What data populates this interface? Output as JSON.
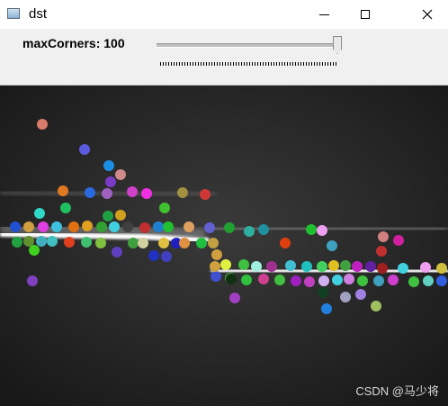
{
  "window": {
    "title": "dst"
  },
  "toolbar": {
    "label": "maxCorners: 100",
    "slider_value": 100,
    "slider_max": 100
  },
  "watermark": "CSDN @马少将",
  "corners": [
    [
      "#d97b6a",
      47,
      138
    ],
    [
      "#5b5be0",
      94,
      166
    ],
    [
      "#1b8fe6",
      121,
      184
    ],
    [
      "#d08a8a",
      134,
      194
    ],
    [
      "#7a3ac8",
      123,
      202
    ],
    [
      "#e07820",
      70,
      212
    ],
    [
      "#2a6ae0",
      100,
      214
    ],
    [
      "#a060c0",
      119,
      215
    ],
    [
      "#d040c8",
      147,
      213
    ],
    [
      "#f030e0",
      163,
      215
    ],
    [
      "#a09040",
      203,
      214
    ],
    [
      "#d03838",
      228,
      216
    ],
    [
      "#20c060",
      73,
      231
    ],
    [
      "#40c030",
      183,
      231
    ],
    [
      "#30d8c8",
      44,
      237
    ],
    [
      "#20a040",
      120,
      240
    ],
    [
      "#d0a020",
      134,
      239
    ],
    [
      "#2050d0",
      17,
      252
    ],
    [
      "#d0a040",
      32,
      252
    ],
    [
      "#e040e0",
      48,
      252
    ],
    [
      "#40c0e0",
      63,
      252
    ],
    [
      "#e07010",
      82,
      252
    ],
    [
      "#e0a020",
      97,
      251
    ],
    [
      "#30a030",
      113,
      252
    ],
    [
      "#40d0e0",
      127,
      252
    ],
    [
      "#404040",
      142,
      252
    ],
    [
      "#c03030",
      161,
      253
    ],
    [
      "#2080d0",
      176,
      252
    ],
    [
      "#20c030",
      187,
      252
    ],
    [
      "#e0a060",
      210,
      252
    ],
    [
      "#6060d0",
      233,
      253
    ],
    [
      "#20a030",
      255,
      253
    ],
    [
      "#30b0a0",
      277,
      257
    ],
    [
      "#2090a0",
      293,
      255
    ],
    [
      "#20c030",
      346,
      255
    ],
    [
      "#f0a0f0",
      358,
      256
    ],
    [
      "#20a040",
      19,
      269
    ],
    [
      "#609030",
      32,
      268
    ],
    [
      "#40b0c0",
      46,
      268
    ],
    [
      "#40c0c0",
      58,
      268
    ],
    [
      "#e04020",
      77,
      269
    ],
    [
      "#40c070",
      96,
      269
    ],
    [
      "#80c040",
      112,
      270
    ],
    [
      "#40a040",
      148,
      270
    ],
    [
      "#d0d0a0",
      159,
      270
    ],
    [
      "#e0c040",
      182,
      270
    ],
    [
      "#2020c0",
      196,
      270
    ],
    [
      "#e09040",
      205,
      270
    ],
    [
      "#20c040",
      224,
      270
    ],
    [
      "#c0a040",
      237,
      270
    ],
    [
      "#e04010",
      317,
      270
    ],
    [
      "#40a0c0",
      369,
      273
    ],
    [
      "#d020a0",
      443,
      267
    ],
    [
      "#d0a040",
      241,
      283
    ],
    [
      "#40d020",
      38,
      278
    ],
    [
      "#6040c0",
      130,
      280
    ],
    [
      "#2030c0",
      171,
      284
    ],
    [
      "#4040c0",
      185,
      285
    ],
    [
      "#c03030",
      424,
      279
    ],
    [
      "#e0f040",
      251,
      294
    ],
    [
      "#40c040",
      271,
      294
    ],
    [
      "#a0f0e0",
      285,
      296
    ],
    [
      "#a03090",
      302,
      296
    ],
    [
      "#40c0d0",
      323,
      295
    ],
    [
      "#20c0c0",
      341,
      296
    ],
    [
      "#40d060",
      358,
      296
    ],
    [
      "#e0c020",
      371,
      295
    ],
    [
      "#40a040",
      384,
      295
    ],
    [
      "#c020c0",
      397,
      296
    ],
    [
      "#6020a0",
      412,
      296
    ],
    [
      "#a02020",
      425,
      298
    ],
    [
      "#40d0e0",
      448,
      298
    ],
    [
      "#f0a0f0",
      473,
      297
    ],
    [
      "#d0c040",
      491,
      298
    ],
    [
      "#4050d0",
      240,
      307
    ],
    [
      "#40a040",
      256,
      309
    ],
    [
      "#30c040",
      274,
      311
    ],
    [
      "#d04090",
      293,
      310
    ],
    [
      "#40c040",
      311,
      311
    ],
    [
      "#a020c0",
      329,
      312
    ],
    [
      "#c040c0",
      344,
      313
    ],
    [
      "#d0b0f0",
      360,
      312
    ],
    [
      "#40d0e0",
      375,
      311
    ],
    [
      "#d080e0",
      388,
      310
    ],
    [
      "#40c040",
      403,
      312
    ],
    [
      "#40a0c0",
      421,
      312
    ],
    [
      "#d040d0",
      437,
      311
    ],
    [
      "#40c040",
      460,
      313
    ],
    [
      "#60d0c0",
      476,
      312
    ],
    [
      "#3060e0",
      491,
      312
    ],
    [
      "#8040c0",
      36,
      312
    ],
    [
      "#103010",
      257,
      310
    ],
    [
      "#104020",
      359,
      325
    ],
    [
      "#a0a0c0",
      384,
      330
    ],
    [
      "#a080e0",
      401,
      327
    ],
    [
      "#a040c0",
      261,
      331
    ],
    [
      "#2080e0",
      363,
      343
    ],
    [
      "#a0c060",
      418,
      340
    ],
    [
      "#d0a040",
      239,
      296
    ],
    [
      "#d08080",
      426,
      263
    ]
  ]
}
